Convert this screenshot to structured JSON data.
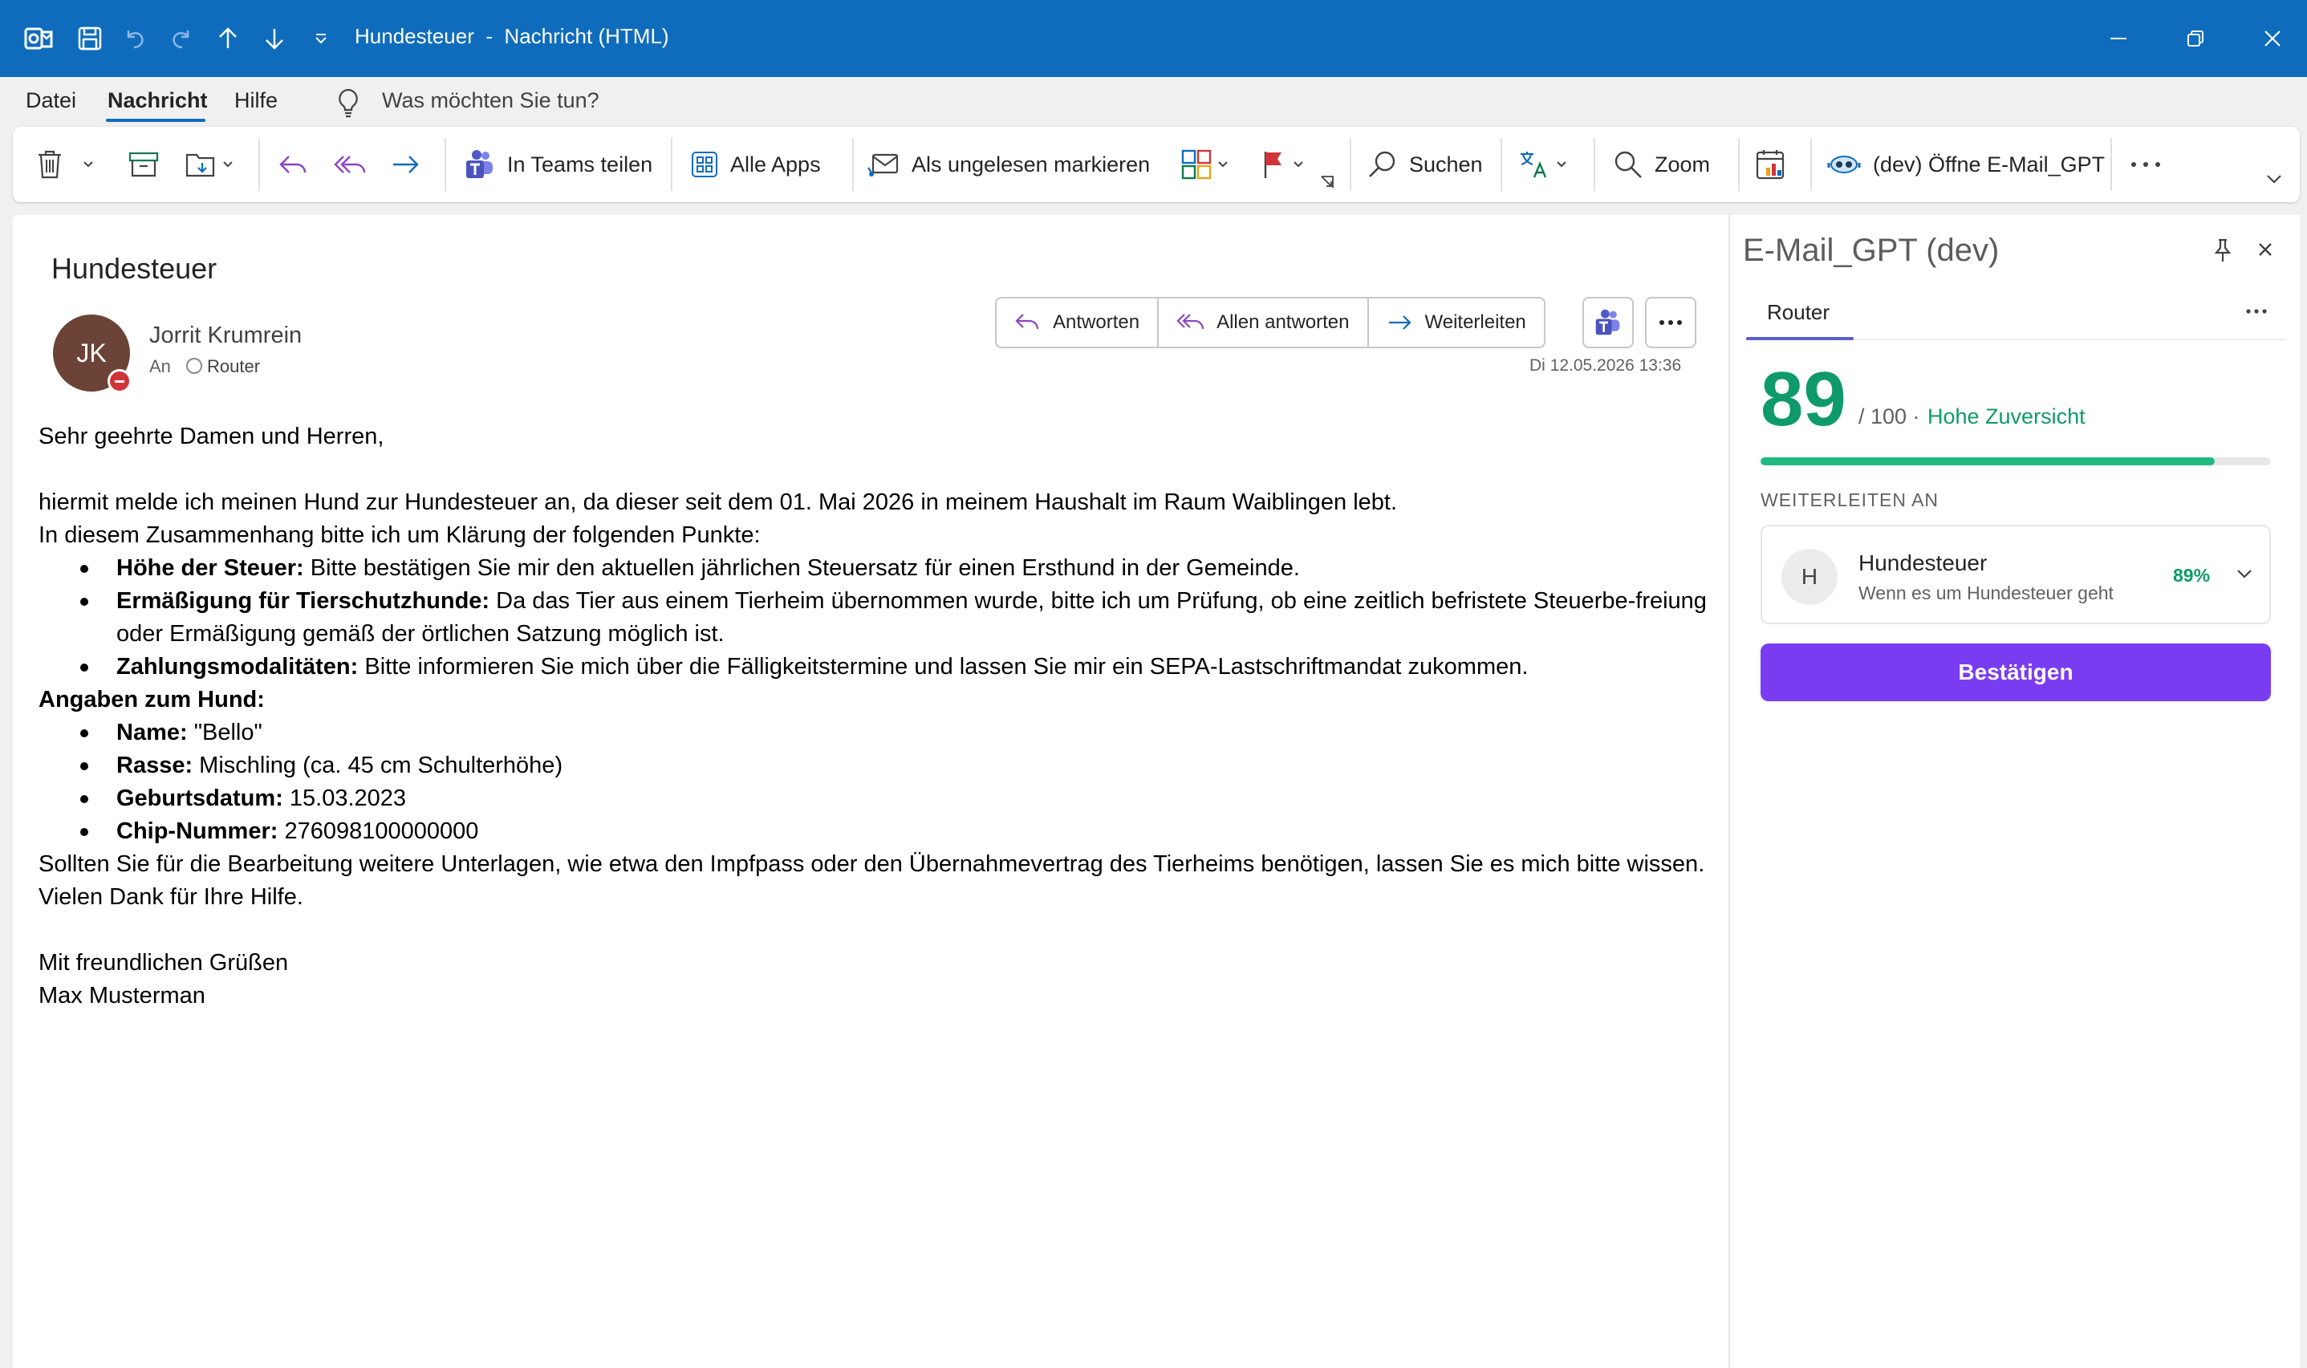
{
  "window": {
    "title": "Hundesteuer  -  Nachricht (HTML)"
  },
  "menu": {
    "items": [
      "Datei",
      "Nachricht",
      "Hilfe"
    ],
    "active": "Nachricht",
    "tell_me_placeholder": "Was möchten Sie tun?"
  },
  "ribbon": {
    "teams_share": "In Teams teilen",
    "all_apps": "Alle Apps",
    "mark_unread": "Als ungelesen markieren",
    "search": "Suchen",
    "zoom": "Zoom",
    "open_gpt": "(dev) Öffne E-Mail_GPT"
  },
  "message": {
    "subject": "Hundesteuer",
    "sender_initials": "JK",
    "sender_name": "Jorrit Krumrein",
    "to_label": "An",
    "to_name": "Router",
    "date": "Di 12.05.2026 13:36",
    "actions": {
      "reply": "Antworten",
      "reply_all": "Allen antworten",
      "forward": "Weiterleiten"
    },
    "body": {
      "greeting": "Sehr geehrte Damen und Herren,",
      "intro": "hiermit melde ich meinen Hund zur Hundesteuer an, da dieser seit dem 01. Mai 2026 in meinem Haushalt im Raum Waiblingen lebt.",
      "context": "In diesem Zusammenhang bitte ich um Klärung der folgenden Punkte:",
      "points": [
        {
          "label": "Höhe der Steuer:",
          "text": " Bitte bestätigen Sie mir den aktuellen jährlichen Steuersatz für einen Ersthund in der Gemeinde."
        },
        {
          "label": "Ermäßigung für Tierschutzhunde:",
          "text": " Da das Tier aus einem Tierheim übernommen wurde, bitte ich um Prüfung, ob eine zeitlich befristete Steuerbe-freiung oder Ermäßigung gemäß der örtlichen Satzung möglich ist."
        },
        {
          "label": "Zahlungsmodalitäten:",
          "text": " Bitte informieren Sie mich über die Fälligkeitstermine und lassen Sie mir ein SEPA-Lastschriftmandat zukommen."
        }
      ],
      "dog_heading": "Angaben zum Hund:",
      "dog": [
        {
          "label": "Name:",
          "text": " \"Bello\""
        },
        {
          "label": "Rasse:",
          "text": " Mischling (ca. 45 cm Schulterhöhe)"
        },
        {
          "label": "Geburtsdatum:",
          "text": " 15.03.2023"
        },
        {
          "label": "Chip-Nummer:",
          "text": " 276098100000000"
        }
      ],
      "closing1": "Sollten Sie für die Bearbeitung weitere Unterlagen, wie etwa den Impfpass oder den Übernahmevertrag des Tierheims benötigen, lassen Sie es mich bitte wissen.",
      "closing2": "Vielen Dank für Ihre Hilfe.",
      "regards": "Mit freundlichen Grüßen",
      "signature": "Max Musterman"
    }
  },
  "addin": {
    "title": "E-Mail_GPT (dev)",
    "tab": "Router",
    "score": "89",
    "score_max": "/ 100 ·",
    "confidence": "Hohe Zuversicht",
    "progress_pct": 89,
    "forward_label": "WEITERLEITEN AN",
    "route": {
      "initial": "H",
      "name": "Hundesteuer",
      "description": "Wenn es um Hundesteuer geht",
      "percent": "89%"
    },
    "confirm": "Bestätigen"
  },
  "colors": {
    "accent": "#0f6cbd",
    "score": "#0e9a6b",
    "confirm": "#7a3cf0",
    "avatar": "#6b4437"
  }
}
